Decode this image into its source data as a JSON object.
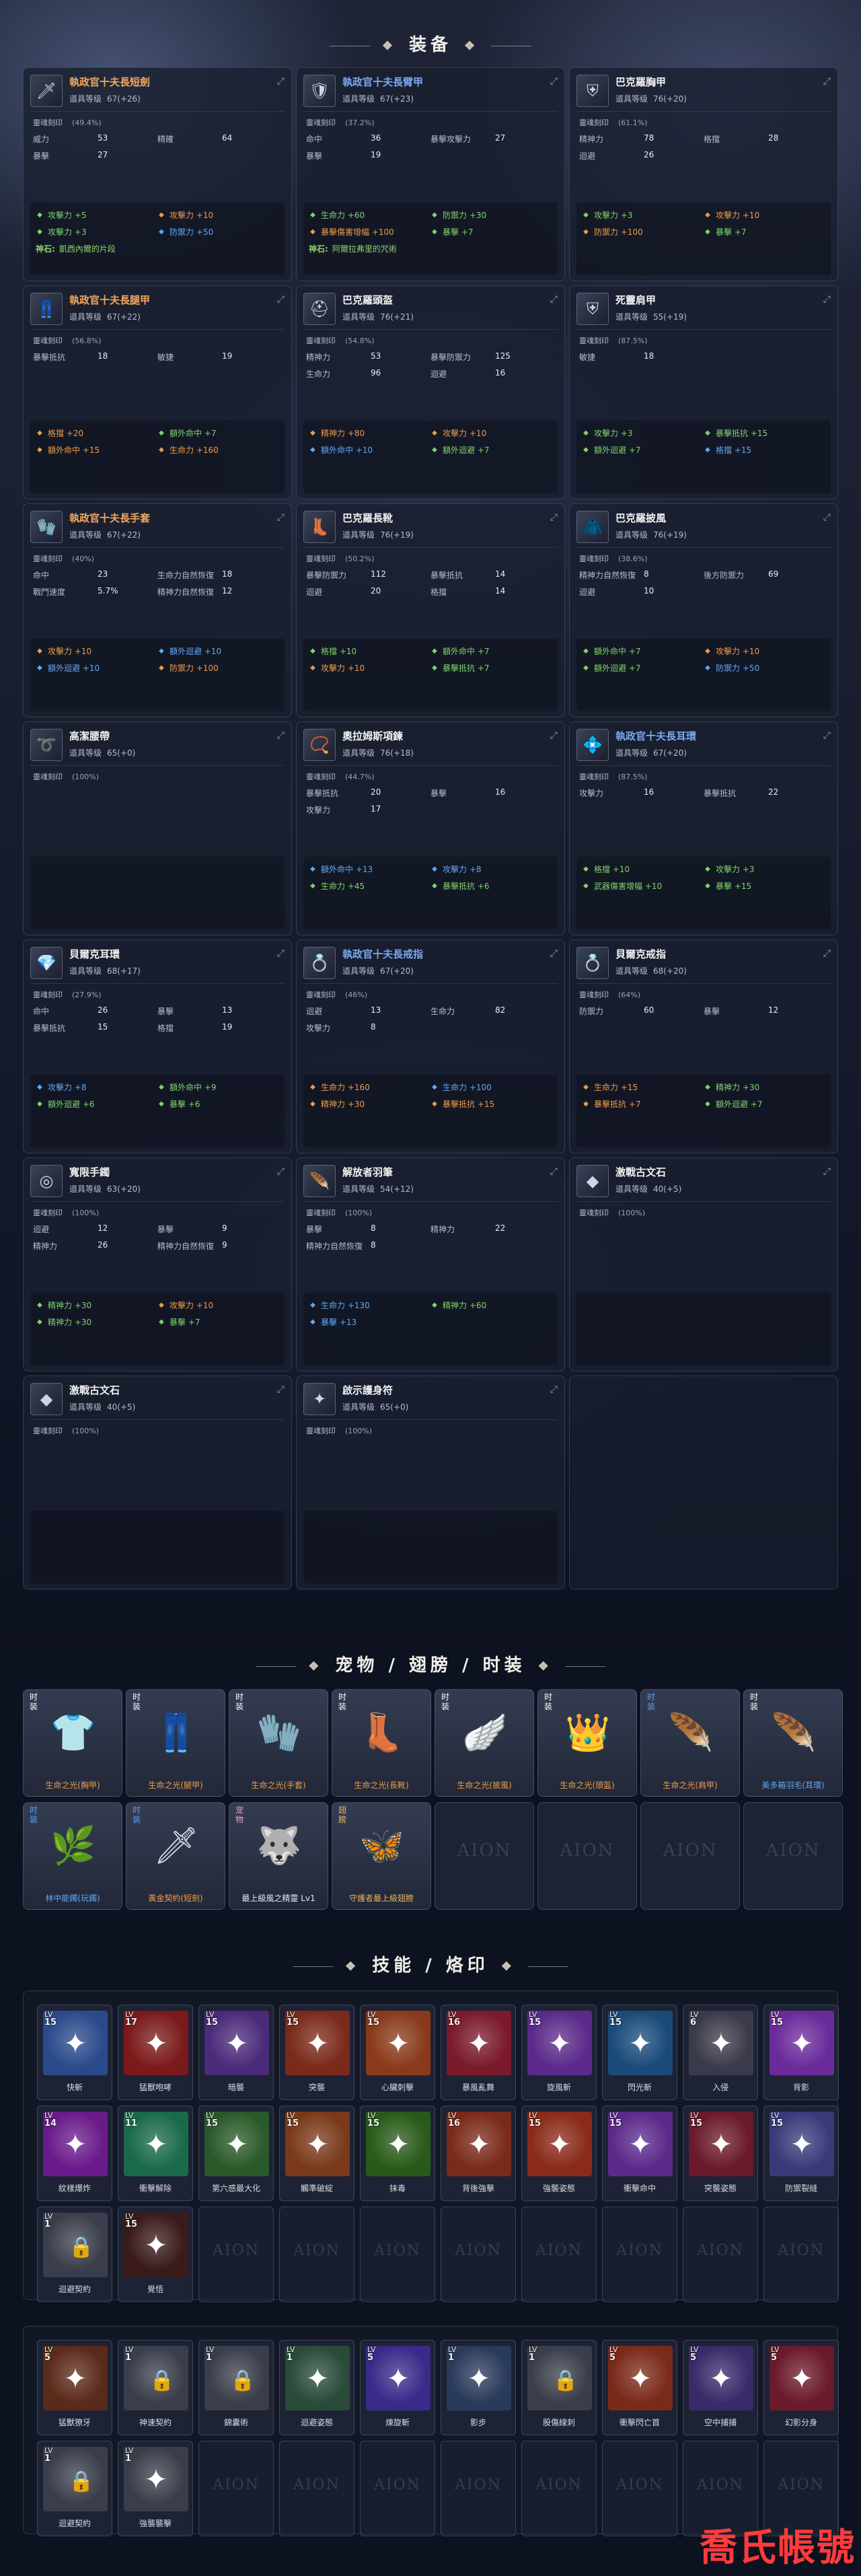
{
  "sections": {
    "equipment": "装备",
    "pets": "宠物 / 翅膀 / 时装",
    "skills": "技能 / 烙印"
  },
  "labels": {
    "item_level": "道具等级",
    "soul_seal": "靈魂刻印"
  },
  "equipment": [
    {
      "name": "執政官十夫長短劍",
      "color": "orange",
      "icon": "dagger-icon",
      "glyph": "🗡",
      "level": "67(+26)",
      "soul": "(49.4%)",
      "stats": [
        [
          "威力",
          "53"
        ],
        [
          "精確",
          "64"
        ],
        [
          "暴擊",
          "27"
        ]
      ],
      "bonuses": [
        [
          "green",
          "攻擊力 +5"
        ],
        [
          "orange",
          "攻擊力 +10"
        ],
        [
          "green",
          "攻擊力 +3"
        ],
        [
          "blue",
          "防禦力 +50"
        ]
      ],
      "note": [
        "神石:",
        "凱西內爾的片段"
      ]
    },
    {
      "name": "執政官十夫長臂甲",
      "color": "blue",
      "icon": "pauldron-icon",
      "glyph": "🛡",
      "level": "67(+23)",
      "soul": "(37.2%)",
      "stats": [
        [
          "命中",
          "36"
        ],
        [
          "暴擊攻擊力",
          "27"
        ],
        [
          "暴擊",
          "19"
        ]
      ],
      "bonuses": [
        [
          "green",
          "生命力 +60"
        ],
        [
          "green",
          "防禦力 +30"
        ],
        [
          "orange",
          "暴擊傷害增幅 +100"
        ],
        [
          "green",
          "暴擊 +7"
        ]
      ],
      "note": [
        "神石:",
        "阿爾拉弗里的咒術"
      ]
    },
    {
      "name": "巴克羅胸甲",
      "color": "white",
      "icon": "chest-armor-icon",
      "glyph": "⛨",
      "level": "76(+20)",
      "soul": "(61.1%)",
      "stats": [
        [
          "精神力",
          "78"
        ],
        [
          "格擋",
          "28"
        ],
        [
          "迴避",
          "26"
        ]
      ],
      "bonuses": [
        [
          "green",
          "攻擊力 +3"
        ],
        [
          "orange",
          "攻擊力 +10"
        ],
        [
          "orange",
          "防禦力 +100"
        ],
        [
          "green",
          "暴擊 +7"
        ]
      ]
    },
    {
      "name": "執政官十夫長腿甲",
      "color": "orange",
      "icon": "leg-armor-icon",
      "glyph": "👖",
      "level": "67(+22)",
      "soul": "(56.8%)",
      "stats": [
        [
          "暴擊抵抗",
          "18"
        ],
        [
          "敏捷",
          "19"
        ]
      ],
      "bonuses": [
        [
          "orange",
          "格擋 +20"
        ],
        [
          "green",
          "額外命中 +7"
        ],
        [
          "orange",
          "額外命中 +15"
        ],
        [
          "orange",
          "生命力 +160"
        ]
      ]
    },
    {
      "name": "巴克羅頭盔",
      "color": "white",
      "icon": "helmet-icon",
      "glyph": "⛑",
      "level": "76(+21)",
      "soul": "(54.8%)",
      "stats": [
        [
          "精神力",
          "53"
        ],
        [
          "暴擊防禦力",
          "125"
        ],
        [
          "生命力",
          "96"
        ],
        [
          "迴避",
          "16"
        ]
      ],
      "bonuses": [
        [
          "orange",
          "精神力 +80"
        ],
        [
          "orange",
          "攻擊力 +10"
        ],
        [
          "blue",
          "額外命中 +10"
        ],
        [
          "green",
          "額外迴避 +7"
        ]
      ]
    },
    {
      "name": "死靈肩甲",
      "color": "white",
      "icon": "shoulder-armor-icon",
      "glyph": "⛨",
      "level": "55(+19)",
      "soul": "(87.5%)",
      "stats": [
        [
          "敏捷",
          "18"
        ]
      ],
      "bonuses": [
        [
          "green",
          "攻擊力 +3"
        ],
        [
          "green",
          "暴擊抵抗 +15"
        ],
        [
          "green",
          "額外迴避 +7"
        ],
        [
          "blue",
          "格擋 +15"
        ]
      ]
    },
    {
      "name": "執政官十夫長手套",
      "color": "orange",
      "icon": "gloves-icon",
      "glyph": "🧤",
      "level": "67(+22)",
      "soul": "(40%)",
      "stats": [
        [
          "命中",
          "23"
        ],
        [
          "生命力自然恢復",
          "18"
        ],
        [
          "戰鬥速度",
          "5.7%"
        ],
        [
          "精神力自然恢復",
          "12"
        ]
      ],
      "bonuses": [
        [
          "orange",
          "攻擊力 +10"
        ],
        [
          "blue",
          "額外迴避 +10"
        ],
        [
          "blue",
          "額外迴避 +10"
        ],
        [
          "orange",
          "防禦力 +100"
        ]
      ]
    },
    {
      "name": "巴克羅長靴",
      "color": "white",
      "icon": "boots-icon",
      "glyph": "👢",
      "level": "76(+19)",
      "soul": "(50.2%)",
      "stats": [
        [
          "暴擊防禦力",
          "112"
        ],
        [
          "暴擊抵抗",
          "14"
        ],
        [
          "迴避",
          "20"
        ],
        [
          "格擋",
          "14"
        ]
      ],
      "bonuses": [
        [
          "green",
          "格擋 +10"
        ],
        [
          "green",
          "額外命中 +7"
        ],
        [
          "orange",
          "攻擊力 +10"
        ],
        [
          "green",
          "暴擊抵抗 +7"
        ]
      ]
    },
    {
      "name": "巴克羅披風",
      "color": "white",
      "icon": "cape-icon",
      "glyph": "🧥",
      "level": "76(+19)",
      "soul": "(38.6%)",
      "stats": [
        [
          "精神力自然恢復",
          "8"
        ],
        [
          "後方防禦力",
          "69"
        ],
        [
          "迴避",
          "10"
        ]
      ],
      "bonuses": [
        [
          "green",
          "額外命中 +7"
        ],
        [
          "orange",
          "攻擊力 +10"
        ],
        [
          "green",
          "額外迴避 +7"
        ],
        [
          "blue",
          "防禦力 +50"
        ]
      ]
    },
    {
      "name": "高潔腰帶",
      "color": "white",
      "icon": "belt-icon",
      "glyph": "➰",
      "level": "65(+0)",
      "soul": "(100%)",
      "stats": [],
      "bonuses": []
    },
    {
      "name": "奧拉姆斯項鍊",
      "color": "white",
      "icon": "necklace-icon",
      "glyph": "📿",
      "level": "76(+18)",
      "soul": "(44.7%)",
      "stats": [
        [
          "暴擊抵抗",
          "20"
        ],
        [
          "暴擊",
          "16"
        ],
        [
          "攻擊力",
          "17"
        ]
      ],
      "bonuses": [
        [
          "blue",
          "額外命中 +13"
        ],
        [
          "blue",
          "攻擊力 +8"
        ],
        [
          "green",
          "生命力 +45"
        ],
        [
          "green",
          "暴擊抵抗 +6"
        ]
      ]
    },
    {
      "name": "執政官十夫長耳環",
      "color": "blue",
      "icon": "earring-icon",
      "glyph": "💠",
      "level": "67(+20)",
      "soul": "(87.5%)",
      "stats": [
        [
          "攻擊力",
          "16"
        ],
        [
          "暴擊抵抗",
          "22"
        ]
      ],
      "bonuses": [
        [
          "green",
          "格擋 +10"
        ],
        [
          "green",
          "攻擊力 +3"
        ],
        [
          "green",
          "武器傷害增幅 +10"
        ],
        [
          "green",
          "暴擊 +15"
        ]
      ]
    },
    {
      "name": "貝爾克耳環",
      "color": "white",
      "icon": "earring-icon",
      "glyph": "💎",
      "level": "68(+17)",
      "soul": "(27.9%)",
      "stats": [
        [
          "命中",
          "26"
        ],
        [
          "暴擊",
          "13"
        ],
        [
          "暴擊抵抗",
          "15"
        ],
        [
          "格擋",
          "19"
        ]
      ],
      "bonuses": [
        [
          "blue",
          "攻擊力 +8"
        ],
        [
          "green",
          "額外命中 +9"
        ],
        [
          "green",
          "額外迴避 +6"
        ],
        [
          "green",
          "暴擊 +6"
        ]
      ]
    },
    {
      "name": "執政官十夫長戒指",
      "color": "blue",
      "icon": "ring-icon",
      "glyph": "💍",
      "level": "67(+20)",
      "soul": "(46%)",
      "stats": [
        [
          "迴避",
          "13"
        ],
        [
          "生命力",
          "82"
        ],
        [
          "攻擊力",
          "8"
        ]
      ],
      "bonuses": [
        [
          "orange",
          "生命力 +160"
        ],
        [
          "blue",
          "生命力 +100"
        ],
        [
          "orange",
          "精神力 +30"
        ],
        [
          "orange",
          "暴擊抵抗 +15"
        ]
      ]
    },
    {
      "name": "貝爾克戒指",
      "color": "white",
      "icon": "ring-icon",
      "glyph": "💍",
      "level": "68(+20)",
      "soul": "(64%)",
      "stats": [
        [
          "防禦力",
          "60"
        ],
        [
          "暴擊",
          "12"
        ]
      ],
      "bonuses": [
        [
          "orange",
          "生命力 +15"
        ],
        [
          "green",
          "精神力 +30"
        ],
        [
          "orange",
          "暴擊抵抗 +7"
        ],
        [
          "green",
          "額外迴避 +7"
        ]
      ]
    },
    {
      "name": "寬限手鐲",
      "color": "white",
      "icon": "bracelet-icon",
      "glyph": "◎",
      "level": "63(+20)",
      "soul": "(100%)",
      "stats": [
        [
          "迴避",
          "12"
        ],
        [
          "暴擊",
          "9"
        ],
        [
          "精神力",
          "26"
        ],
        [
          "精神力自然恢復",
          "9"
        ]
      ],
      "bonuses": [
        [
          "green",
          "精神力 +30"
        ],
        [
          "orange",
          "攻擊力 +10"
        ],
        [
          "green",
          "精神力 +30"
        ],
        [
          "green",
          "暴擊 +7"
        ]
      ]
    },
    {
      "name": "解放者羽筆",
      "color": "white",
      "icon": "feather-icon",
      "glyph": "🪶",
      "level": "54(+12)",
      "soul": "(100%)",
      "stats": [
        [
          "暴擊",
          "8"
        ],
        [
          "精神力",
          "22"
        ],
        [
          "精神力自然恢復",
          "8"
        ]
      ],
      "bonuses": [
        [
          "blue",
          "生命力 +130"
        ],
        [
          "green",
          "精神力 +60"
        ],
        [
          "blue",
          "暴擊 +13"
        ]
      ]
    },
    {
      "name": "激戰古文石",
      "color": "white",
      "icon": "rune-stone-icon",
      "glyph": "◆",
      "level": "40(+5)",
      "soul": "(100%)",
      "stats": [],
      "bonuses": []
    },
    {
      "name": "激戰古文石",
      "color": "white",
      "icon": "rune-stone-icon",
      "glyph": "◆",
      "level": "40(+5)",
      "soul": "(100%)",
      "stats": [],
      "bonuses": []
    },
    {
      "name": "啟示護身符",
      "color": "white",
      "icon": "amulet-icon",
      "glyph": "✦",
      "level": "65(+0)",
      "soul": "(100%)",
      "stats": [],
      "bonuses": []
    }
  ],
  "pets": [
    {
      "tag": "时装",
      "tag_color": "white",
      "name": "生命之光(胸甲)",
      "name_color": "orange",
      "icon": "costume-chest-icon",
      "glyph": "👕"
    },
    {
      "tag": "时装",
      "tag_color": "white",
      "name": "生命之光(腿甲)",
      "name_color": "orange",
      "icon": "costume-legs-icon",
      "glyph": "👖"
    },
    {
      "tag": "时装",
      "tag_color": "white",
      "name": "生命之光(手套)",
      "name_color": "orange",
      "icon": "costume-gloves-icon",
      "glyph": "🧤"
    },
    {
      "tag": "时装",
      "tag_color": "white",
      "name": "生命之光(長靴)",
      "name_color": "orange",
      "icon": "costume-boots-icon",
      "glyph": "👢"
    },
    {
      "tag": "时装",
      "tag_color": "white",
      "name": "生命之光(披風)",
      "name_color": "orange",
      "icon": "costume-cape-icon",
      "glyph": "🪽"
    },
    {
      "tag": "时装",
      "tag_color": "white",
      "name": "生命之光(頭盔)",
      "name_color": "orange",
      "icon": "costume-helmet-icon",
      "glyph": "👑"
    },
    {
      "tag": "时装",
      "tag_color": "blue",
      "name": "生命之光(肩甲)",
      "name_color": "orange",
      "icon": "costume-shoulder-icon",
      "glyph": "🪶"
    },
    {
      "tag": "时装",
      "tag_color": "white",
      "name": "美多箱羽毛(耳環)",
      "name_color": "blue",
      "icon": "costume-earring-icon",
      "glyph": "🪶"
    },
    {
      "tag": "时装",
      "tag_color": "blue",
      "name": "林中能鐲(玩鐲)",
      "name_color": "blue",
      "icon": "costume-bracelet-icon",
      "glyph": "🌿"
    },
    {
      "tag": "时装",
      "tag_color": "blue",
      "name": "黃金契約(短劍)",
      "name_color": "orange",
      "icon": "costume-dagger-icon",
      "glyph": "🗡"
    },
    {
      "tag": "宠物",
      "tag_color": "pink",
      "name": "最上級風之精靈 Lv1",
      "name_color": "white",
      "icon": "wind-spirit-pet-icon",
      "glyph": "🐺"
    },
    {
      "tag": "翅膀",
      "tag_color": "gold",
      "name": "守護者最上級翅膀",
      "name_color": "gold",
      "icon": "wings-icon",
      "glyph": "🦋"
    },
    {
      "empty": true
    },
    {
      "empty": true
    },
    {
      "empty": true
    },
    {
      "empty": true
    }
  ],
  "aion_mark": "AION",
  "skills_active": [
    {
      "lv": "15",
      "name": "快斬",
      "icon": "quick-slash-icon",
      "bg": "#2a4a8a"
    },
    {
      "lv": "17",
      "name": "猛獸咆哮",
      "icon": "beast-roar-icon",
      "bg": "#7a1a1a"
    },
    {
      "lv": "15",
      "name": "暗襲",
      "icon": "ambush-icon",
      "bg": "#4a2a7a"
    },
    {
      "lv": "15",
      "name": "突襲",
      "icon": "assault-icon",
      "bg": "#7a2a1a"
    },
    {
      "lv": "15",
      "name": "心臟刺擊",
      "icon": "heart-stab-icon",
      "bg": "#8a3a1a"
    },
    {
      "lv": "16",
      "name": "暴風亂舞",
      "icon": "storm-dance-icon",
      "bg": "#7a1a2a"
    },
    {
      "lv": "15",
      "name": "旋風斬",
      "icon": "whirlwind-slash-icon",
      "bg": "#5a2a8a"
    },
    {
      "lv": "15",
      "name": "閃光斬",
      "icon": "flash-slash-icon",
      "bg": "#1a4a7a"
    },
    {
      "lv": "6",
      "name": "入侵",
      "icon": "invade-icon",
      "bg": "#3a3a4a"
    },
    {
      "lv": "15",
      "name": "背影",
      "icon": "back-shadow-icon",
      "bg": "#6a2a9a"
    },
    {
      "lv": "14",
      "name": "紋樣爆炸",
      "icon": "rune-explosion-icon",
      "bg": "#6a1a8a"
    },
    {
      "lv": "11",
      "name": "衝擊解除",
      "icon": "shock-release-icon",
      "bg": "#1a6a4a"
    },
    {
      "lv": "15",
      "name": "第六感最大化",
      "icon": "sixth-sense-icon",
      "bg": "#2a5a2a"
    },
    {
      "lv": "15",
      "name": "觸準破綻",
      "icon": "weak-point-icon",
      "bg": "#7a3a1a"
    },
    {
      "lv": "15",
      "name": "抹毒",
      "icon": "poison-coat-icon",
      "bg": "#2a5a1a"
    },
    {
      "lv": "16",
      "name": "背後強擊",
      "icon": "back-strike-icon",
      "bg": "#7a2a1a"
    },
    {
      "lv": "15",
      "name": "強襲姿態",
      "icon": "assault-stance-icon",
      "bg": "#8a2a1a"
    },
    {
      "lv": "15",
      "name": "衝擊命中",
      "icon": "impact-hit-icon",
      "bg": "#5a2a8a"
    },
    {
      "lv": "15",
      "name": "突襲姿態",
      "icon": "raid-stance-icon",
      "bg": "#6a1a2a"
    },
    {
      "lv": "15",
      "name": "防禦裂縫",
      "icon": "defense-crack-icon",
      "bg": "#3a3a7a"
    },
    {
      "lv": "1",
      "name": "迴避契約",
      "icon": "evasion-pact-icon",
      "bg": "#3a3e4a",
      "locked": true
    },
    {
      "lv": "15",
      "name": "覺悟",
      "icon": "resolve-icon",
      "bg": "#3a1a1a"
    },
    {
      "empty": true
    },
    {
      "empty": true
    },
    {
      "empty": true
    },
    {
      "empty": true
    },
    {
      "empty": true
    },
    {
      "empty": true
    },
    {
      "empty": true
    },
    {
      "empty": true
    }
  ],
  "skills_passive": [
    {
      "lv": "5",
      "name": "猛獸獠牙",
      "icon": "beast-fang-icon",
      "bg": "#5a2a1a"
    },
    {
      "lv": "1",
      "name": "神速契約",
      "icon": "haste-pact-icon",
      "bg": "#3a3e4a",
      "locked": true
    },
    {
      "lv": "1",
      "name": "錦囊術",
      "icon": "tactic-icon",
      "bg": "#3a3e4a",
      "locked": true
    },
    {
      "lv": "1",
      "name": "迴避姿態",
      "icon": "evasion-stance-icon",
      "bg": "#2a4a3a"
    },
    {
      "lv": "5",
      "name": "煉旋斬",
      "icon": "spin-slash-icon",
      "bg": "#3a2a8a"
    },
    {
      "lv": "1",
      "name": "影步",
      "icon": "shadow-step-icon",
      "bg": "#2a3a5a"
    },
    {
      "lv": "1",
      "name": "股傷線刺",
      "icon": "thigh-stab-icon",
      "bg": "#3a3e4a",
      "locked": true
    },
    {
      "lv": "5",
      "name": "衝擊閃亡首",
      "icon": "flash-strike-icon",
      "bg": "#7a2a1a"
    },
    {
      "lv": "5",
      "name": "空中捕捕",
      "icon": "aerial-bind-icon",
      "bg": "#3a2a6a"
    },
    {
      "lv": "5",
      "name": "幻影分身",
      "icon": "phantom-clone-icon",
      "bg": "#6a1a2a"
    },
    {
      "lv": "1",
      "name": "迴避契約",
      "icon": "evasion-pact-icon",
      "bg": "#3a3e4a",
      "locked": true
    },
    {
      "lv": "1",
      "name": "強襲襲擊",
      "icon": "strike-assault-icon",
      "bg": "#3a3e4a"
    },
    {
      "empty": true
    },
    {
      "empty": true
    },
    {
      "empty": true
    },
    {
      "empty": true
    },
    {
      "empty": true
    },
    {
      "empty": true
    },
    {
      "empty": true
    },
    {
      "empty": true
    }
  ],
  "watermark": "喬氏帳號"
}
